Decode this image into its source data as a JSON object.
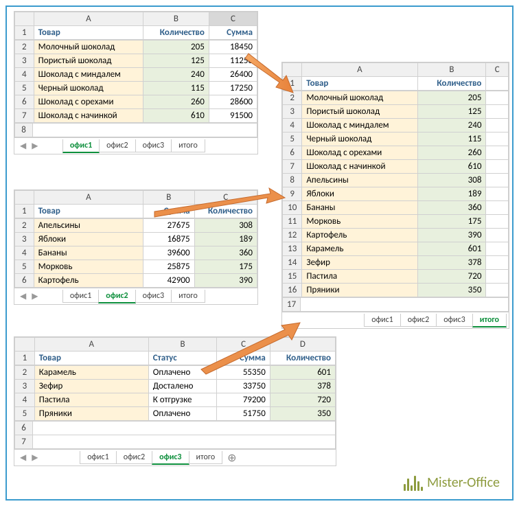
{
  "sheet1": {
    "cols": [
      "A",
      "B",
      "C"
    ],
    "headers": {
      "A": "Товар",
      "B": "Количество",
      "C": "Сумма"
    },
    "rows": [
      {
        "A": "Молочный шоколад",
        "B": 205,
        "C": 18450
      },
      {
        "A": "Пористый шоколад",
        "B": 125,
        "C": 11250
      },
      {
        "A": "Шоколад с миндалем",
        "B": 240,
        "C": 26400
      },
      {
        "A": "Черный шоколад",
        "B": 115,
        "C": 17250
      },
      {
        "A": "Шоколад с орехами",
        "B": 260,
        "C": 28600
      },
      {
        "A": "Шоколад с начинкой",
        "B": 610,
        "C": 91500
      }
    ],
    "tabs": [
      "офис1",
      "офис2",
      "офис3",
      "итого"
    ],
    "active": "офис1"
  },
  "sheet2": {
    "cols": [
      "A",
      "B",
      "C"
    ],
    "headers": {
      "A": "Товар",
      "B": "Сумма",
      "C": "Количество"
    },
    "rows": [
      {
        "A": "Апельсины",
        "B": 27675,
        "C": 308
      },
      {
        "A": "Яблоки",
        "B": 16875,
        "C": 189
      },
      {
        "A": "Бананы",
        "B": 39600,
        "C": 360
      },
      {
        "A": "Морковь",
        "B": 25875,
        "C": 175
      },
      {
        "A": "Картофель",
        "B": 42900,
        "C": 390
      }
    ],
    "tabs": [
      "офис1",
      "офис2",
      "офис3",
      "итого"
    ],
    "active": "офис2"
  },
  "sheet3": {
    "cols": [
      "A",
      "B",
      "C",
      "D"
    ],
    "headers": {
      "A": "Товар",
      "B": "Статус",
      "C": "Сумма",
      "D": "Количество"
    },
    "rows": [
      {
        "A": "Карамель",
        "B": "Оплачено",
        "C": 55350,
        "D": 601
      },
      {
        "A": "Зефир",
        "B": "Досталено",
        "C": 33750,
        "D": 378
      },
      {
        "A": "Пастила",
        "B": "К отгрузке",
        "C": 79200,
        "D": 720
      },
      {
        "A": "Пряники",
        "B": "Оплачено",
        "C": 51750,
        "D": 350
      }
    ],
    "tabs": [
      "офис1",
      "офис2",
      "офис3",
      "итого"
    ],
    "active": "офис3"
  },
  "sheetResult": {
    "cols": [
      "A",
      "B",
      "C"
    ],
    "headers": {
      "A": "Товар",
      "B": "Количество"
    },
    "rows": [
      {
        "A": "Молочный шоколад",
        "B": 205
      },
      {
        "A": "Пористый шоколад",
        "B": 125
      },
      {
        "A": "Шоколад с миндалем",
        "B": 240
      },
      {
        "A": "Черный шоколад",
        "B": 115
      },
      {
        "A": "Шоколад с орехами",
        "B": 260
      },
      {
        "A": "Шоколад с начинкой",
        "B": 610
      },
      {
        "A": "Апельсины",
        "B": 308
      },
      {
        "A": "Яблоки",
        "B": 189
      },
      {
        "A": "Бананы",
        "B": 360
      },
      {
        "A": "Морковь",
        "B": 175
      },
      {
        "A": "Картофель",
        "B": 390
      },
      {
        "A": "Карамель",
        "B": 601
      },
      {
        "A": "Зефир",
        "B": 378
      },
      {
        "A": "Пастила",
        "B": 720
      },
      {
        "A": "Пряники",
        "B": 350
      }
    ],
    "tabs": [
      "офис1",
      "офис2",
      "офис3",
      "итого"
    ],
    "active": "итого"
  },
  "logo": "Mister-Office",
  "chart_data": {
    "type": "table",
    "description": "Excel worksheets showing consolidation of three office product lists into one summary list",
    "office1": [
      [
        "Молочный шоколад",
        205,
        18450
      ],
      [
        "Пористый шоколад",
        125,
        11250
      ],
      [
        "Шоколад с миндалем",
        240,
        26400
      ],
      [
        "Черный шоколад",
        115,
        17250
      ],
      [
        "Шоколад с орехами",
        260,
        28600
      ],
      [
        "Шоколад с начинкой",
        610,
        91500
      ]
    ],
    "office2": [
      [
        "Апельсины",
        27675,
        308
      ],
      [
        "Яблоки",
        16875,
        189
      ],
      [
        "Бананы",
        39600,
        360
      ],
      [
        "Морковь",
        25875,
        175
      ],
      [
        "Картофель",
        42900,
        390
      ]
    ],
    "office3": [
      [
        "Карамель",
        "Оплачено",
        55350,
        601
      ],
      [
        "Зефир",
        "Досталено",
        33750,
        378
      ],
      [
        "Пастила",
        "К отгрузке",
        79200,
        720
      ],
      [
        "Пряники",
        "Оплачено",
        51750,
        350
      ]
    ],
    "result_columns": [
      "Товар",
      "Количество"
    ]
  }
}
